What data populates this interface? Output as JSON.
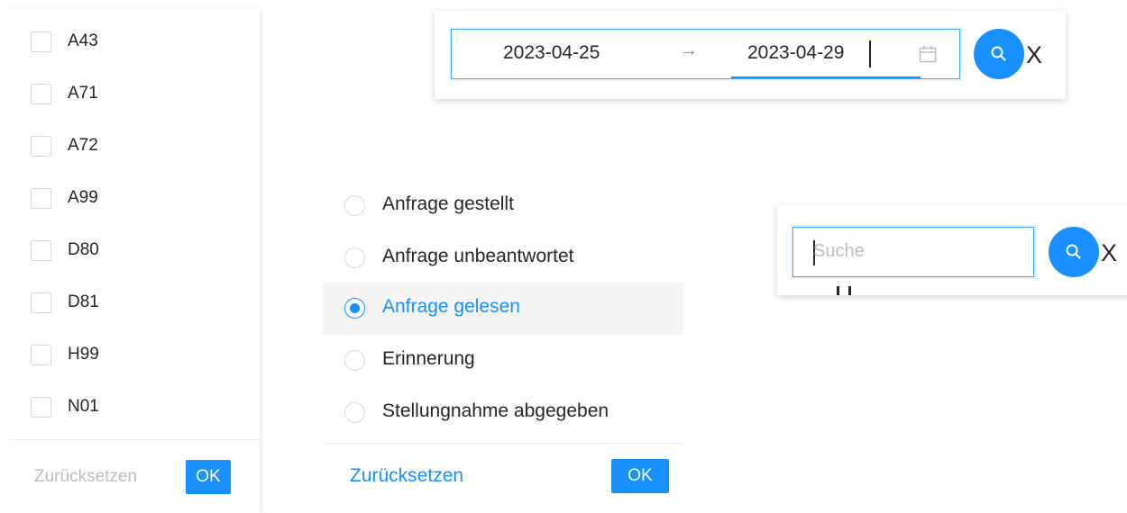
{
  "checkbox_filter": {
    "items": [
      {
        "label": "A43",
        "checked": false
      },
      {
        "label": "A71",
        "checked": false
      },
      {
        "label": "A72",
        "checked": false
      },
      {
        "label": "A99",
        "checked": false
      },
      {
        "label": "D80",
        "checked": false
      },
      {
        "label": "D81",
        "checked": false
      },
      {
        "label": "H99",
        "checked": false
      },
      {
        "label": "N01",
        "checked": false
      }
    ],
    "reset_label": "Zurücksetzen",
    "ok_label": "OK"
  },
  "date_filter": {
    "start_date": "2023-04-25",
    "separator": "→",
    "end_date": "2023-04-29",
    "calendar_icon": "calendar-icon",
    "search_icon": "search-icon",
    "close_label": "X"
  },
  "radio_filter": {
    "options": [
      {
        "label": "Anfrage gestellt",
        "selected": false
      },
      {
        "label": "Anfrage unbeantwortet",
        "selected": false
      },
      {
        "label": "Anfrage gelesen",
        "selected": true
      },
      {
        "label": "Erinnerung",
        "selected": false
      },
      {
        "label": "Stellungnahme abgegeben",
        "selected": false
      }
    ],
    "reset_label": "Zurücksetzen",
    "ok_label": "OK"
  },
  "text_filter": {
    "placeholder": "Suche",
    "search_icon": "search-icon",
    "close_label": "X"
  },
  "colors": {
    "primary": "#1890ff",
    "disabled_text": "#bfbfbf",
    "selected_bg": "#f5f5f5"
  }
}
